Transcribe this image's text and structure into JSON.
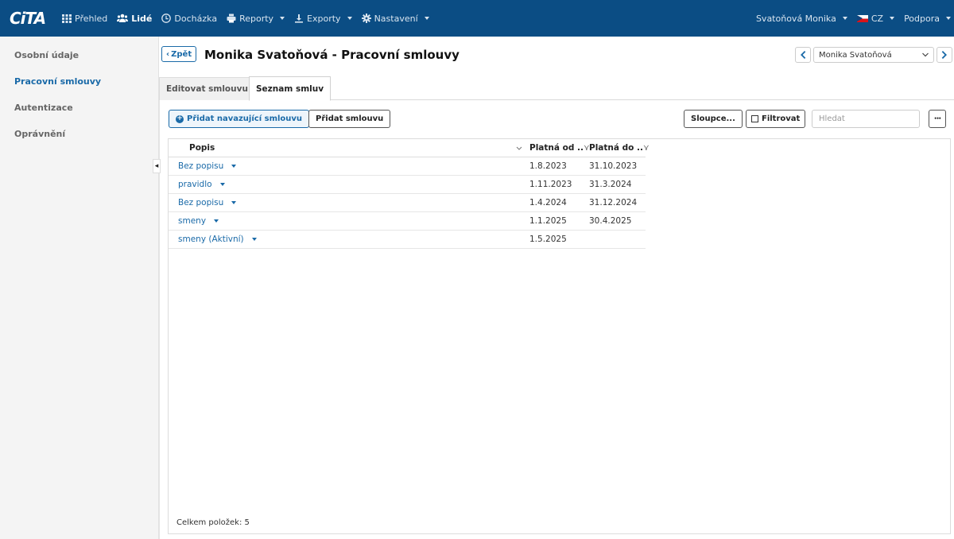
{
  "navbar": {
    "logo": "CiTA",
    "items": [
      {
        "label": "Přehled",
        "icon": "grid-icon",
        "active": false,
        "caret": false
      },
      {
        "label": "Lidé",
        "icon": "users-icon",
        "active": true,
        "caret": false
      },
      {
        "label": "Docházka",
        "icon": "clock-icon",
        "active": false,
        "caret": false
      },
      {
        "label": "Reporty",
        "icon": "printer-icon",
        "active": false,
        "caret": true
      },
      {
        "label": "Exporty",
        "icon": "export-icon",
        "active": false,
        "caret": true
      },
      {
        "label": "Nastavení",
        "icon": "gear-icon",
        "active": false,
        "caret": true
      }
    ],
    "user": "Svatoňová Monika",
    "language": "CZ",
    "support": "Podpora"
  },
  "sidebar": {
    "items": [
      {
        "label": "Osobní údaje",
        "active": false
      },
      {
        "label": "Pracovní smlouvy",
        "active": true
      },
      {
        "label": "Autentizace",
        "active": false
      },
      {
        "label": "Oprávnění",
        "active": false
      }
    ]
  },
  "header": {
    "back_label": "Zpět",
    "title": "Monika Svatoňová - Pracovní smlouvy",
    "person_select": "Monika Svatoňová"
  },
  "tabs": {
    "edit": "Editovat smlouvu",
    "list": "Seznam smluv"
  },
  "toolbar": {
    "add_follow_label": "Přidat navazující smlouvu",
    "add_label": "Přidat smlouvu",
    "columns_label": "Sloupce...",
    "filter_label": "Filtrovat",
    "search_placeholder": "Hledat",
    "more_label": "•••"
  },
  "table": {
    "columns": {
      "popis": "Popis",
      "od": "Platná od ..",
      "do": "Platná do .."
    },
    "rows": [
      {
        "popis": "Bez popisu",
        "od": "1.8.2023",
        "do": "31.10.2023"
      },
      {
        "popis": "pravidlo",
        "od": "1.11.2023",
        "do": "31.3.2024"
      },
      {
        "popis": "Bez popisu",
        "od": "1.4.2024",
        "do": "31.12.2024"
      },
      {
        "popis": "smeny",
        "od": "1.1.2025",
        "do": "30.4.2025"
      },
      {
        "popis": "smeny (Aktivní)",
        "od": "1.5.2025",
        "do": ""
      }
    ],
    "footer": "Celkem položek: 5"
  },
  "colors": {
    "navbar": "#0b4d84",
    "accent": "#1a6aa8"
  }
}
